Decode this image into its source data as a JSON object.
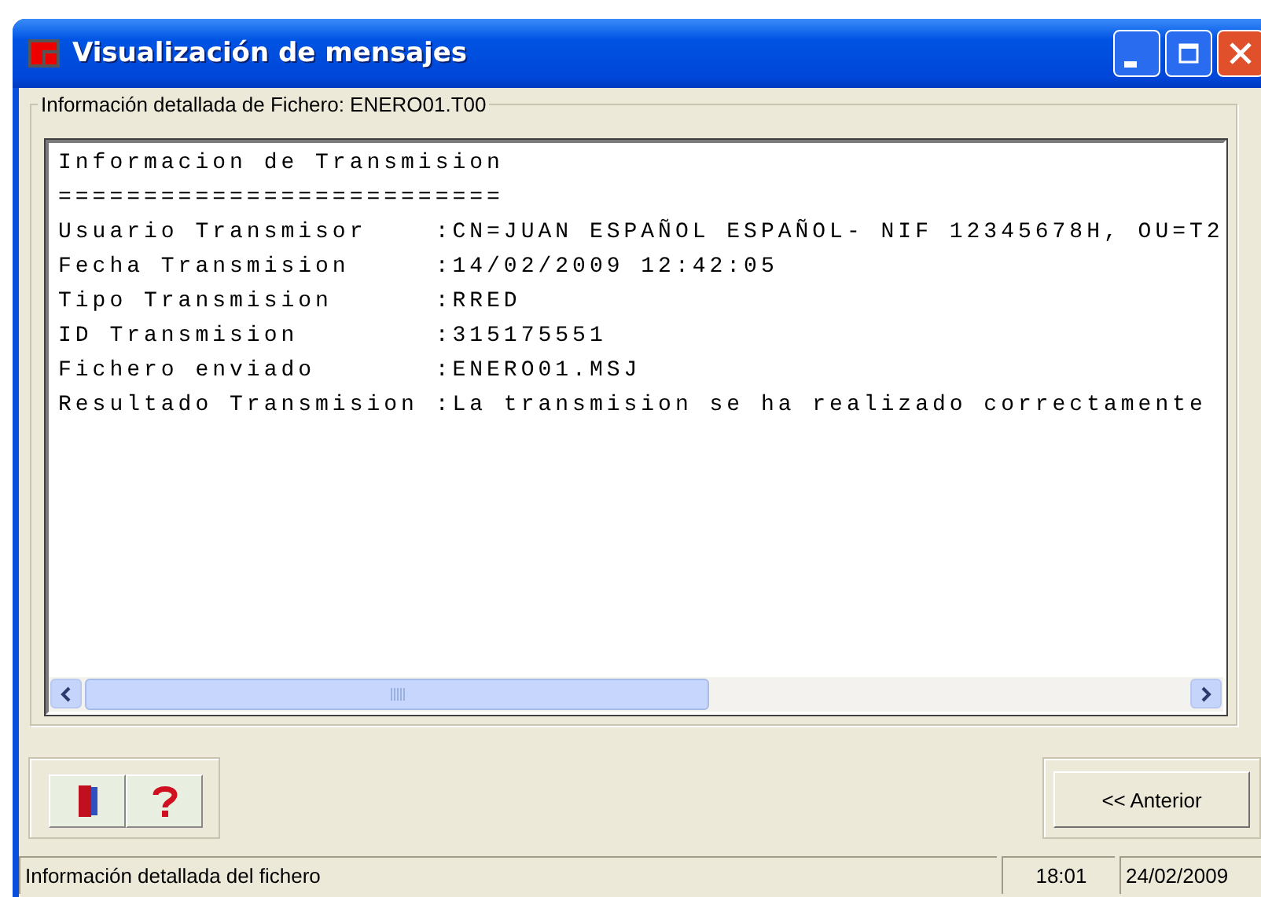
{
  "window": {
    "title": "Visualización de mensajes"
  },
  "group": {
    "legend": "Información detallada de Fichero: ENERO01.T00"
  },
  "text_lines": [
    "Informacion de Transmision",
    "==========================",
    "Usuario Transmisor    :CN=JUAN ESPAÑOL ESPAÑOL- NIF 12345678H, OU=T2",
    "Fecha Transmision     :14/02/2009 12:42:05",
    "Tipo Transmision      :RRED",
    "ID Transmision        :315175551",
    "Fichero enviado       :ENERO01.MSJ",
    "Resultado Transmision :La transmision se ha realizado correctamente"
  ],
  "nav_button": "<< Anterior",
  "status_bar": [
    "Información detallada del fichero",
    "18:01",
    "24/02/2009"
  ]
}
